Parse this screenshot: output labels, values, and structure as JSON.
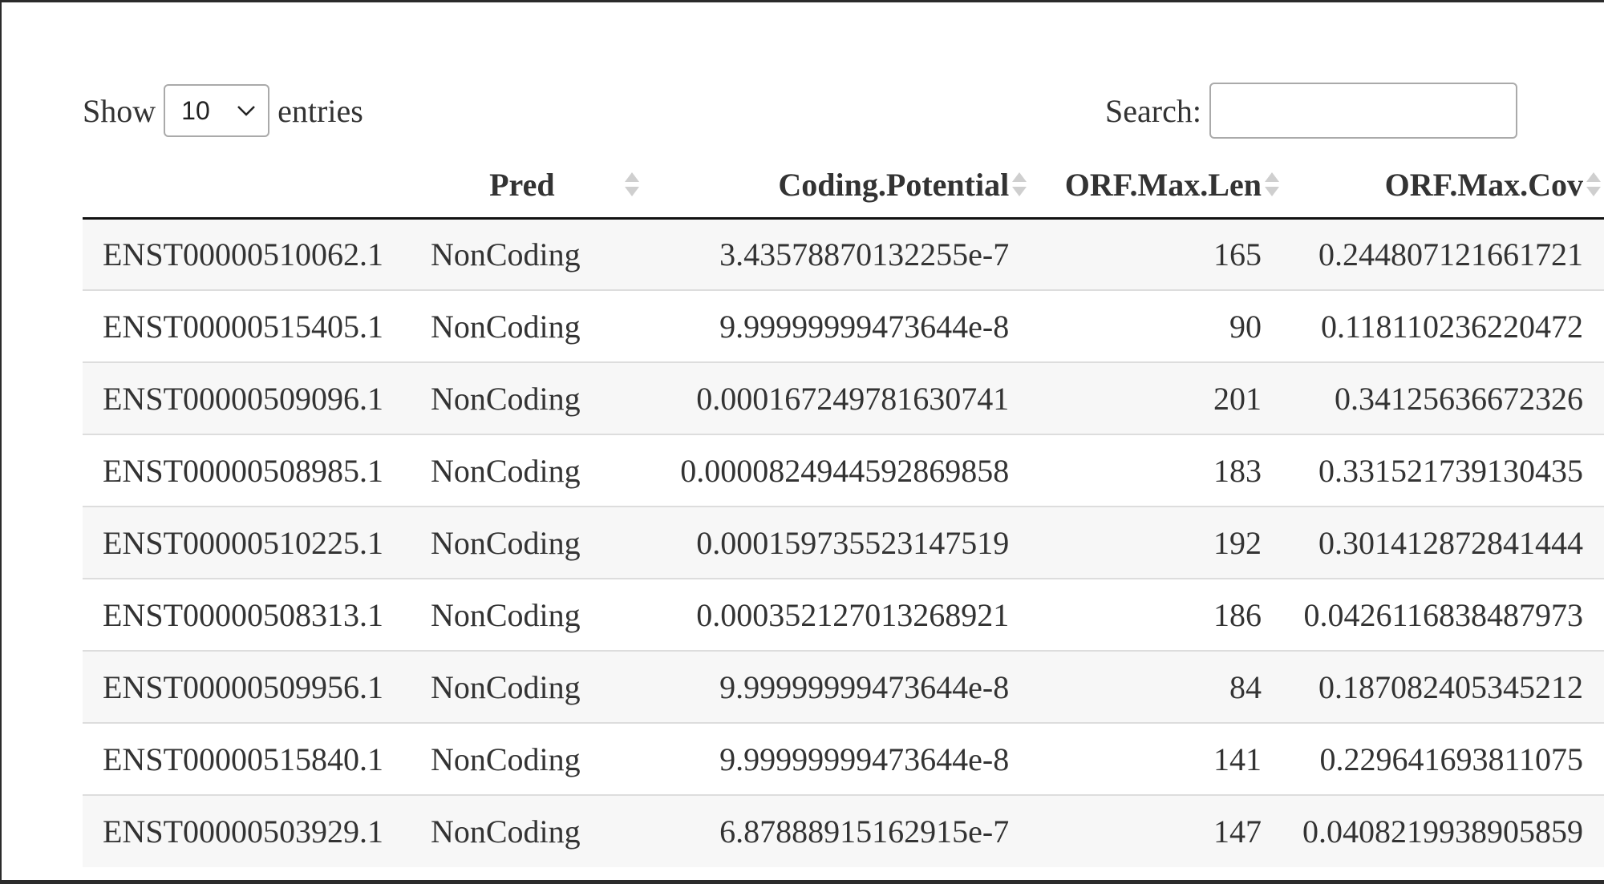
{
  "controls": {
    "show_label": "Show",
    "length_value": "10",
    "entries_label": "entries",
    "search_label": "Search:",
    "search_value": ""
  },
  "table": {
    "columns": [
      "",
      "Pred",
      "Coding.Potential",
      "ORF.Max.Len",
      "ORF.Max.Cov"
    ],
    "rows": [
      [
        "ENST00000510062.1",
        "NonCoding",
        "3.43578870132255e-7",
        "165",
        "0.244807121661721"
      ],
      [
        "ENST00000515405.1",
        "NonCoding",
        "9.99999999473644e-8",
        "90",
        "0.118110236220472"
      ],
      [
        "ENST00000509096.1",
        "NonCoding",
        "0.000167249781630741",
        "201",
        "0.34125636672326"
      ],
      [
        "ENST00000508985.1",
        "NonCoding",
        "0.0000824944592869858",
        "183",
        "0.331521739130435"
      ],
      [
        "ENST00000510225.1",
        "NonCoding",
        "0.000159735523147519",
        "192",
        "0.301412872841444"
      ],
      [
        "ENST00000508313.1",
        "NonCoding",
        "0.000352127013268921",
        "186",
        "0.0426116838487973"
      ],
      [
        "ENST00000509956.1",
        "NonCoding",
        "9.99999999473644e-8",
        "84",
        "0.187082405345212"
      ],
      [
        "ENST00000515840.1",
        "NonCoding",
        "9.99999999473644e-8",
        "141",
        "0.229641693811075"
      ],
      [
        "ENST00000503929.1",
        "NonCoding",
        "6.87888915162915e-7",
        "147",
        "0.0408219938905859"
      ]
    ]
  },
  "icons": {
    "length_chevron": "chevron-down-icon",
    "sort": "sort-both-icon"
  },
  "colors": {
    "text": "#333333",
    "row_stripe": "#f7f7f7",
    "row_border": "#dddddd",
    "header_border": "#111111",
    "sort_icon": "#cfcfcf"
  }
}
